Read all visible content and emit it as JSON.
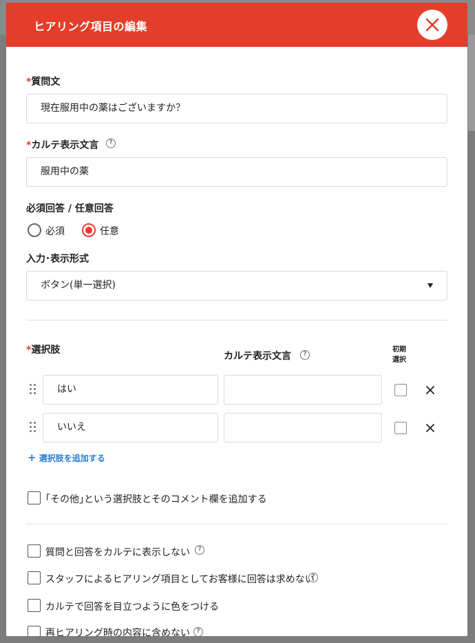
{
  "modal": {
    "title": "ヒアリング項目の編集"
  },
  "question": {
    "required_mark": "*",
    "label": "質問文",
    "value": "現在服用中の薬はございますか？"
  },
  "karte_text": {
    "required_mark": "*",
    "label": "カルテ表示文言",
    "value": "服用中の薬"
  },
  "answer_type": {
    "label": "必須回答 / 任意回答",
    "options": [
      {
        "label": "必須",
        "checked": false
      },
      {
        "label": "任意",
        "checked": true
      }
    ]
  },
  "input_format": {
    "label": "入力･表示形式",
    "selected": "ボタン(単一選択)"
  },
  "choices": {
    "required_mark": "*",
    "label": "選択肢",
    "karte_column": "カルテ表示文言",
    "default_column_line1": "初期",
    "default_column_line2": "選択",
    "rows": [
      {
        "value": "はい",
        "karte": ""
      },
      {
        "value": "いいえ",
        "karte": ""
      }
    ],
    "add_label": "選択肢を追加する",
    "add_icon": "+"
  },
  "options": [
    {
      "label": "｢その他｣という選択肢とそのコメント欄を追加する",
      "help": false
    },
    {
      "label": "質問と回答をカルテに表示しない",
      "help": true
    },
    {
      "label": "スタッフによるヒアリング項目としてお客様に回答は求めない",
      "help": true
    },
    {
      "label": "カルテで回答を目立つように色をつける",
      "help": false
    },
    {
      "label": "再ヒアリング時の内容に含めない",
      "help": true
    }
  ],
  "colors": {
    "accent": "#e43d2a",
    "link": "#2a7fd4"
  },
  "icons": {
    "help": "?"
  }
}
